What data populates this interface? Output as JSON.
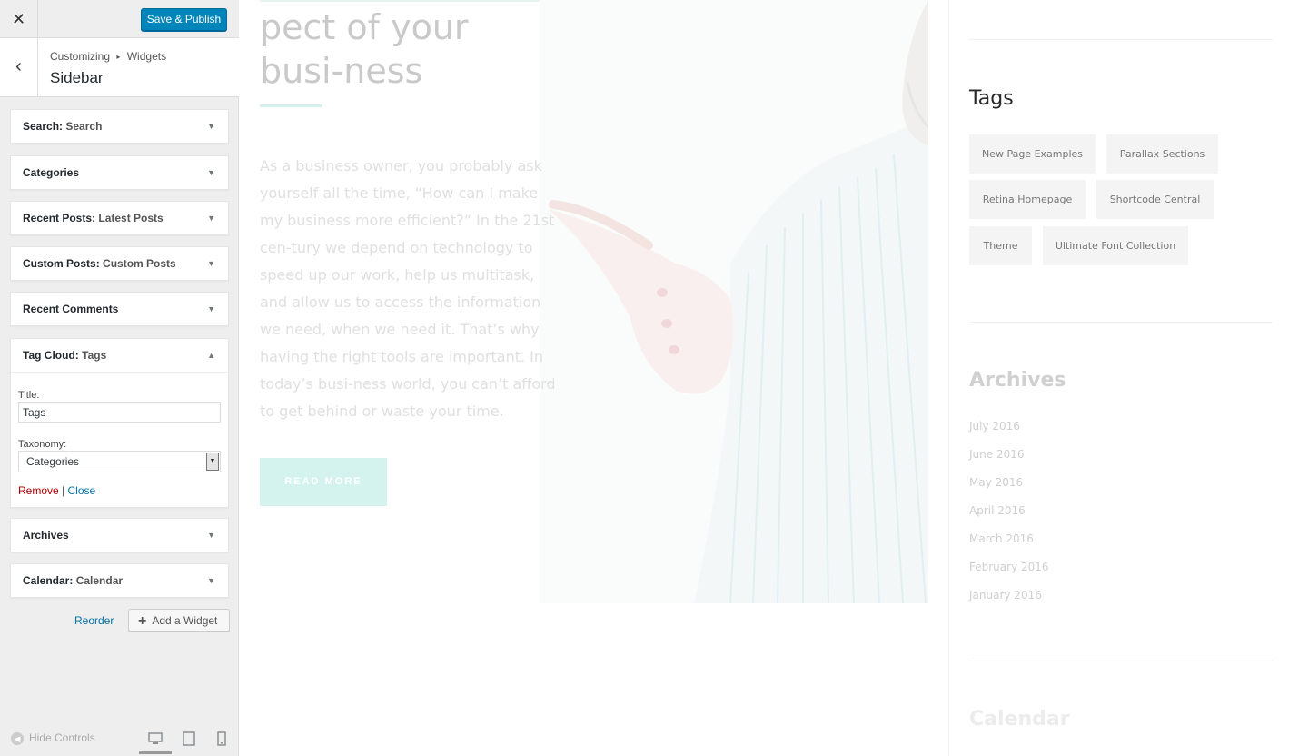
{
  "header": {
    "close_glyph": "✕",
    "publish_label": "Save & Publish",
    "back_glyph": "‹"
  },
  "breadcrumb": {
    "root": "Customizing",
    "separator": "▸",
    "section": "Widgets"
  },
  "section_title": "Sidebar",
  "widgets": [
    {
      "type": "Search",
      "title": "Search"
    },
    {
      "type": "Categories",
      "title": ""
    },
    {
      "type": "Recent Posts",
      "title": "Latest Posts"
    },
    {
      "type": "Custom Posts",
      "title": "Custom Posts"
    },
    {
      "type": "Recent Comments",
      "title": ""
    },
    {
      "type": "Tag Cloud",
      "title": "Tags",
      "expanded": true
    },
    {
      "type": "Archives",
      "title": ""
    },
    {
      "type": "Calendar",
      "title": "Calendar"
    }
  ],
  "colon": ":",
  "arrow_down": "▼",
  "arrow_up": "▲",
  "tag_cloud_form": {
    "title_label": "Title:",
    "title_value": "Tags",
    "taxonomy_label": "Taxonomy:",
    "taxonomy_value": "Categories",
    "remove_label": "Remove",
    "separator": "|",
    "close_label": "Close"
  },
  "reorder_label": "Reorder",
  "add_widget_label": "Add a Widget",
  "add_widget_plus": "+",
  "footer": {
    "hide_controls_label": "Hide Controls",
    "hide_controls_glyph": "◀"
  },
  "preview": {
    "heading": "pect of your busi-ness",
    "body": "As a business owner, you probably ask yourself all the time, “How can I make my business more efficient?” In the 21st cen-tury we depend on technology to speed up our work, help us multitask, and allow us to access the information we need, when we need it. That’s why having the right tools are important. In today’s busi-ness world, you can’t afford to get behind or waste your time.",
    "read_more": "READ MORE",
    "tags_title": "Tags",
    "tags": [
      "New Page Examples",
      "Parallax Sections",
      "Retina Homepage",
      "Shortcode Central",
      "Theme",
      "Ultimate Font Collection"
    ],
    "archives_title": "Archives",
    "archives": [
      "July 2016",
      "June 2016",
      "May 2016",
      "April 2016",
      "March 2016",
      "February 2016",
      "January 2016"
    ],
    "calendar_title": "Calendar"
  },
  "colors": {
    "primary_button": "#0085ba",
    "link": "#0073aa",
    "remove_link": "#a00",
    "accent_mint": "#d5f3ee"
  }
}
